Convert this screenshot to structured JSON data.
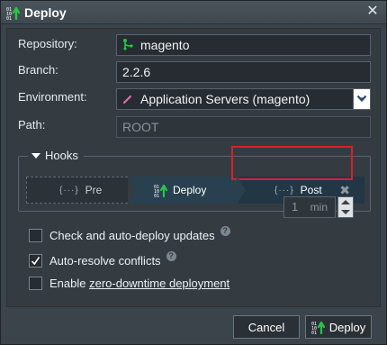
{
  "dialog": {
    "title": "Deploy"
  },
  "form": {
    "repository_label": "Repository:",
    "repository_value": "magento",
    "branch_label": "Branch:",
    "branch_value": "2.2.6",
    "environment_label": "Environment:",
    "environment_value": "Application Servers (magento)",
    "path_label": "Path:",
    "path_value": "ROOT"
  },
  "hooks": {
    "legend": "Hooks",
    "steps": [
      {
        "label": "Pre",
        "marker": "{···}"
      },
      {
        "label": "Deploy"
      },
      {
        "label": "Post",
        "marker": "{···}"
      }
    ],
    "remove_label": "✖"
  },
  "options": {
    "auto_deploy_label": "Check and auto-deploy updates",
    "auto_deploy_checked": false,
    "interval_value": "1",
    "interval_unit": "min",
    "auto_resolve_label": "Auto-resolve conflicts",
    "auto_resolve_checked": true,
    "zero_prefix": "Enable ",
    "zero_link": "zero-downtime deployment",
    "zero_checked": false,
    "help_glyph": "?"
  },
  "buttons": {
    "cancel": "Cancel",
    "deploy": "Deploy"
  },
  "icons": {
    "title": "deploy-binary-arrow-icon",
    "close": "close-icon",
    "repo": "git-branch-icon",
    "env": "pencil-icon",
    "dropdown": "chevron-down-icon"
  },
  "colors": {
    "accent_green": "#29c34a",
    "highlight_red": "#d9202a",
    "env_pink": "#d76fb3"
  }
}
